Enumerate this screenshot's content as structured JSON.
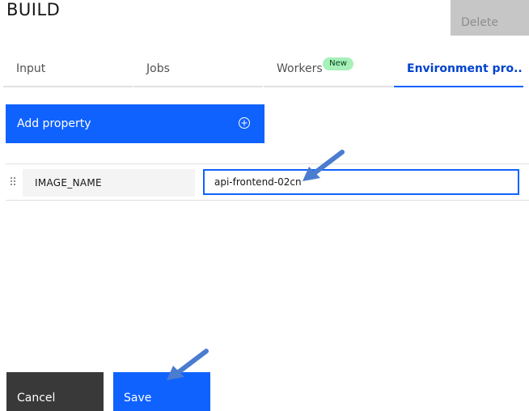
{
  "header": {
    "title": "BUILD",
    "delete_label": "Delete"
  },
  "tabs": [
    {
      "label": "Input"
    },
    {
      "label": "Jobs"
    },
    {
      "label": "Workers",
      "badge": "New"
    },
    {
      "label": "Environment pro..."
    }
  ],
  "add_property": {
    "label": "Add property",
    "icon": "add-circle-icon"
  },
  "properties": [
    {
      "name": "IMAGE_NAME",
      "value": "api-frontend-02cn"
    }
  ],
  "footer": {
    "cancel_label": "Cancel",
    "save_label": "Save"
  },
  "colors": {
    "primary": "#0f62fe",
    "secondary_button": "#393939",
    "disabled_button": "#c6c6c6",
    "badge": "#a7f0ba",
    "annotation_arrow": "#4a7ccf"
  }
}
